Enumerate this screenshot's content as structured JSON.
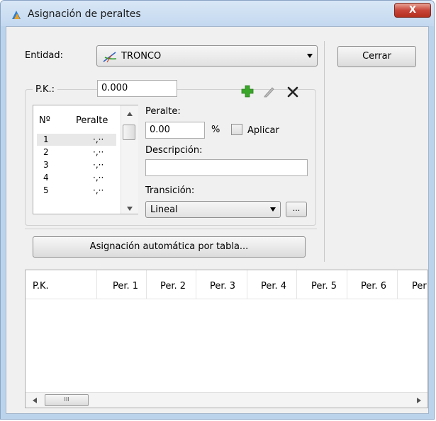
{
  "window": {
    "title": "Asignación de peraltes",
    "close_glyph": "X"
  },
  "entity": {
    "label": "Entidad:",
    "value": "TRONCO",
    "icon": "road-axis-icon"
  },
  "close_button": "Cerrar",
  "pk": {
    "label": "P.K.:",
    "value": "0.000"
  },
  "toolbar": {
    "add_icon": "plus-icon",
    "edit_icon": "pencil-icon",
    "delete_icon": "x-icon"
  },
  "list": {
    "headers": {
      "number": "Nº",
      "cant": "Peralte"
    },
    "rows": [
      {
        "n": "1",
        "v": "·,··"
      },
      {
        "n": "2",
        "v": "·,··"
      },
      {
        "n": "3",
        "v": "·,··"
      },
      {
        "n": "4",
        "v": "·,··"
      },
      {
        "n": "5",
        "v": "·,··"
      }
    ]
  },
  "peralte": {
    "label": "Peralte:",
    "value": "0.00",
    "unit": "%",
    "apply_label": "Aplicar"
  },
  "descripcion": {
    "label": "Descripción:",
    "value": ""
  },
  "transicion": {
    "label": "Transición:",
    "value": "Lineal",
    "more": "..."
  },
  "auto_button": "Asignación automática por tabla...",
  "table": {
    "columns": [
      "P.K.",
      "Per. 1",
      "Per. 2",
      "Per. 3",
      "Per. 4",
      "Per. 5",
      "Per. 6",
      "Per"
    ]
  },
  "hscroll": {
    "thumb_grip": "III"
  },
  "colors": {
    "accent_green": "#3aa629",
    "title_bg": "#c9dcf1",
    "close_red": "#c8453a"
  }
}
